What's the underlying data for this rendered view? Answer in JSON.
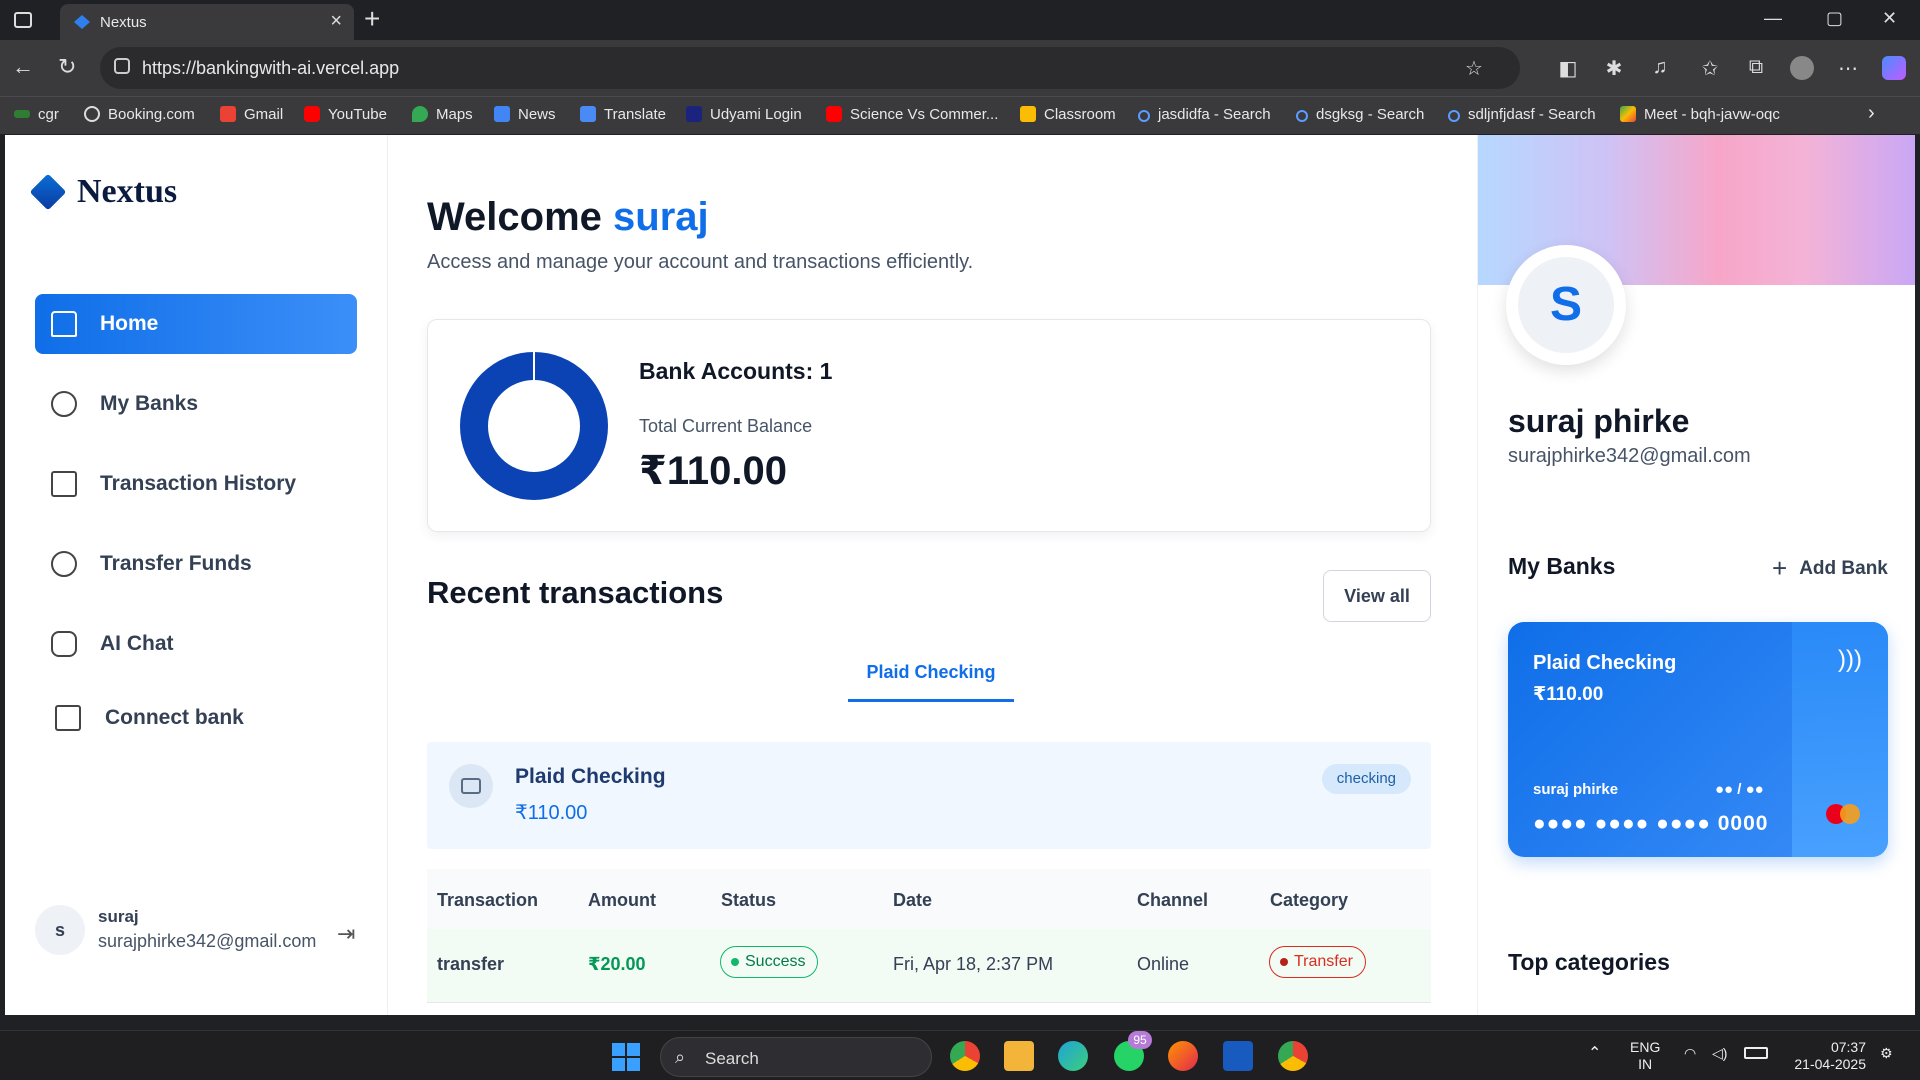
{
  "browser": {
    "tab_title": "Nextus",
    "url": "https://bankingwith-ai.vercel.app",
    "bookmarks": [
      "cgr",
      "Booking.com",
      "Gmail",
      "YouTube",
      "Maps",
      "News",
      "Translate",
      "Udyami Login",
      "Science Vs Commer...",
      "Classroom",
      "jasdidfa - Search",
      "dsgksg - Search",
      "sdljnfjdasf - Search",
      "Meet - bqh-javw-oqc"
    ]
  },
  "sidebar": {
    "brand": "Nextus",
    "items": [
      {
        "label": "Home",
        "icon": "home-icon",
        "active": true
      },
      {
        "label": "My Banks",
        "icon": "dollar-circle-icon"
      },
      {
        "label": "Transaction History",
        "icon": "receipt-icon"
      },
      {
        "label": "Transfer Funds",
        "icon": "transfer-icon"
      },
      {
        "label": "AI Chat",
        "icon": "bot-icon"
      },
      {
        "label": "Connect bank",
        "icon": "card-plus-icon"
      }
    ],
    "user": {
      "initial": "s",
      "name": "suraj",
      "email": "surajphirke342@gmail.com"
    }
  },
  "main": {
    "welcome": "Welcome",
    "user_first": "suraj",
    "subtitle": "Access and manage your account and transactions efficiently.",
    "bank_accounts": "Bank Accounts: 1",
    "total_label": "Total Current Balance",
    "total_balance": "₹110.00",
    "donut_color": "#0b43b5",
    "recent_title": "Recent transactions",
    "view_all": "View all",
    "active_tab": "Plaid Checking",
    "bank_row": {
      "name": "Plaid Checking",
      "balance": "₹110.00",
      "type": "checking"
    },
    "table_headers": [
      "Transaction",
      "Amount",
      "Status",
      "Date",
      "Channel",
      "Category"
    ],
    "rows": [
      {
        "transaction": "transfer",
        "amount": "₹20.00",
        "status": "Success",
        "date": "Fri, Apr 18, 2:37 PM",
        "channel": "Online",
        "category": "Transfer"
      }
    ]
  },
  "right": {
    "initial": "S",
    "name": "suraj phirke",
    "email": "surajphirke342@gmail.com",
    "my_banks": "My Banks",
    "add_bank": "Add Bank",
    "card": {
      "name": "Plaid Checking",
      "balance": "₹110.00",
      "holder": "suraj phirke",
      "expiry": "●● / ●●",
      "number": "●●●● ●●●● ●●●● 0000"
    },
    "top_categories": "Top categories"
  },
  "taskbar": {
    "search": "Search",
    "whatsapp_badge": "95",
    "lang": "ENG",
    "region": "IN",
    "time": "07:37",
    "date": "21-04-2025"
  }
}
